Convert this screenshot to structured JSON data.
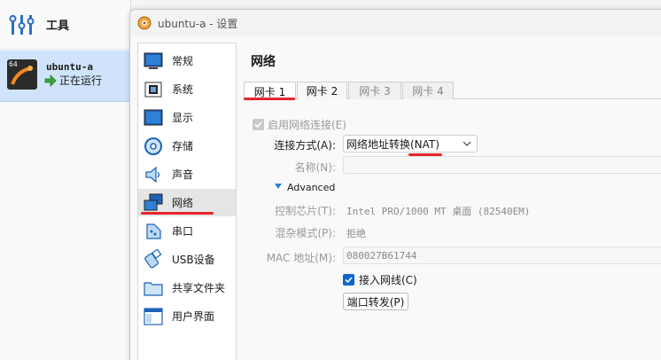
{
  "manager": {
    "tools_label": "工具",
    "vm": {
      "name": "ubuntu-a",
      "state": "正在运行",
      "os_badge": "64"
    }
  },
  "dialog": {
    "title": "ubuntu-a - 设置",
    "categories": [
      {
        "label": "常规",
        "icon": "monitor-icon"
      },
      {
        "label": "系统",
        "icon": "chip-icon"
      },
      {
        "label": "显示",
        "icon": "display-icon"
      },
      {
        "label": "存储",
        "icon": "disk-icon"
      },
      {
        "label": "声音",
        "icon": "speaker-icon"
      },
      {
        "label": "网络",
        "icon": "network-icon"
      },
      {
        "label": "串口",
        "icon": "serial-port-icon"
      },
      {
        "label": "USB设备",
        "icon": "usb-icon"
      },
      {
        "label": "共享文件夹",
        "icon": "folder-icon"
      },
      {
        "label": "用户界面",
        "icon": "window-icon"
      }
    ],
    "selected_category": "网络",
    "page_title": "网络",
    "tabs": [
      "网卡 1",
      "网卡 2",
      "网卡 3",
      "网卡 4"
    ],
    "active_tab": "网卡 1",
    "enable_adapter_label": "启用网络连接(E)",
    "attached_to_label": "连接方式(A):",
    "attached_to_value": "网络地址转换(NAT)",
    "name_label": "名称(N):",
    "advanced_label": "Advanced",
    "adapter_type_label": "控制芯片(T):",
    "adapter_type_value": "Intel PRO/1000 MT 桌面 (82540EM)",
    "promiscuous_label": "混杂模式(P):",
    "promiscuous_value": "拒绝",
    "mac_label": "MAC 地址(M):",
    "mac_value": "080027B61744",
    "cable_connected_label": "接入网线(C)",
    "port_forwarding_label": "端口转发(P)"
  },
  "colors": {
    "accent": "#0f67c9",
    "annotation_red": "#e8242c",
    "selection": "#cfe4fb"
  }
}
